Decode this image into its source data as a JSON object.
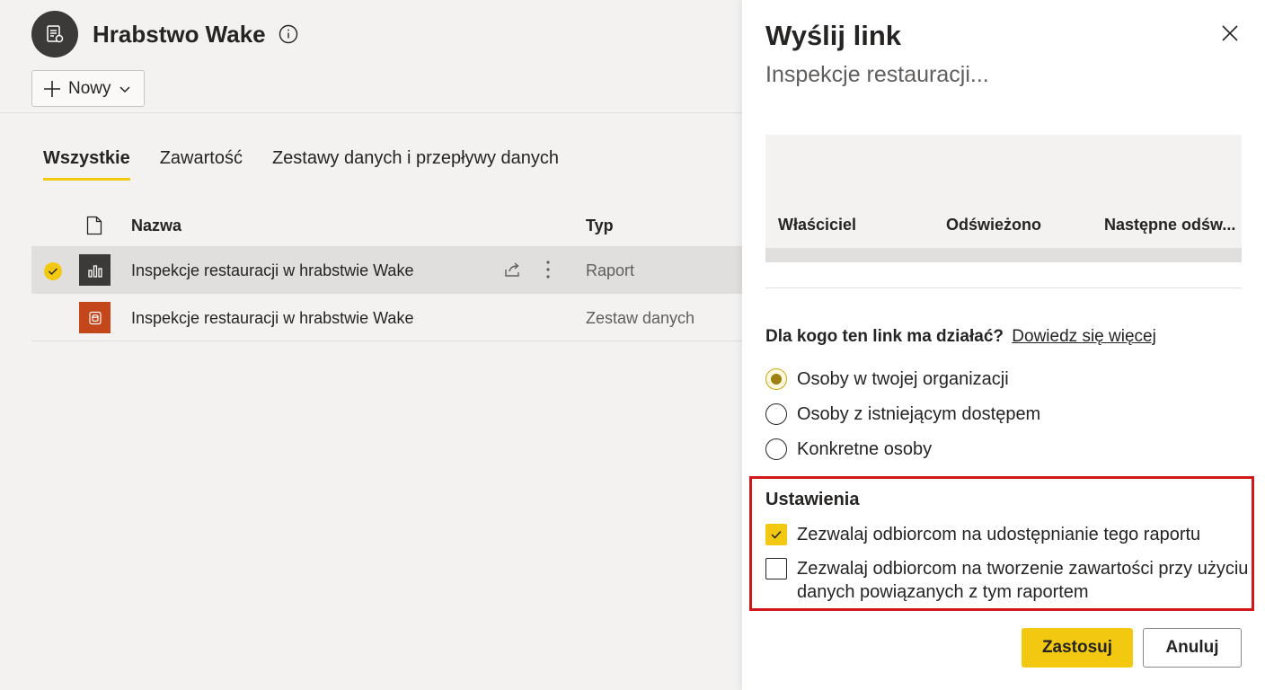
{
  "workspace": {
    "title": "Hrabstwo Wake",
    "new_button_label": "Nowy",
    "tabs": [
      {
        "label": "Wszystkie",
        "active": true
      },
      {
        "label": "Zawartość",
        "active": false
      },
      {
        "label": "Zestawy danych i przepływy danych",
        "active": false
      }
    ],
    "table": {
      "headers": {
        "name": "Nazwa",
        "type": "Typ"
      },
      "rows": [
        {
          "name": "Inspekcje restauracji w hrabstwie Wake",
          "type": "Raport",
          "icon": "report-icon",
          "selected": true
        },
        {
          "name": "Inspekcje restauracji w hrabstwie Wake",
          "type": "Zestaw danych",
          "icon": "dataset-icon",
          "selected": false
        }
      ]
    }
  },
  "panel": {
    "title": "Wyślij link",
    "subtitle": "Inspekcje restauracji...",
    "preview_columns": [
      "Właściciel",
      "Odświeżono",
      "Następne odśw..."
    ],
    "question": "Dla kogo ten link ma działać?",
    "learn_more": "Dowiedz się więcej",
    "audience_options": [
      {
        "label": "Osoby w twojej organizacji",
        "checked": true
      },
      {
        "label": "Osoby z istniejącym dostępem",
        "checked": false
      },
      {
        "label": "Konkretne osoby",
        "checked": false
      }
    ],
    "settings": {
      "title": "Ustawienia",
      "options": [
        {
          "label": "Zezwalaj odbiorcom na udostępnianie tego raportu",
          "checked": true
        },
        {
          "label": "Zezwalaj odbiorcom na tworzenie zawartości przy użyciu danych powiązanych z tym raportem",
          "checked": false
        }
      ]
    },
    "apply_label": "Zastosuj",
    "cancel_label": "Anuluj"
  },
  "colors": {
    "accent": "#f2c811",
    "highlight_border": "#d0171c",
    "report_icon_bg": "#3b3a39",
    "dataset_icon_bg": "#c4461b"
  }
}
